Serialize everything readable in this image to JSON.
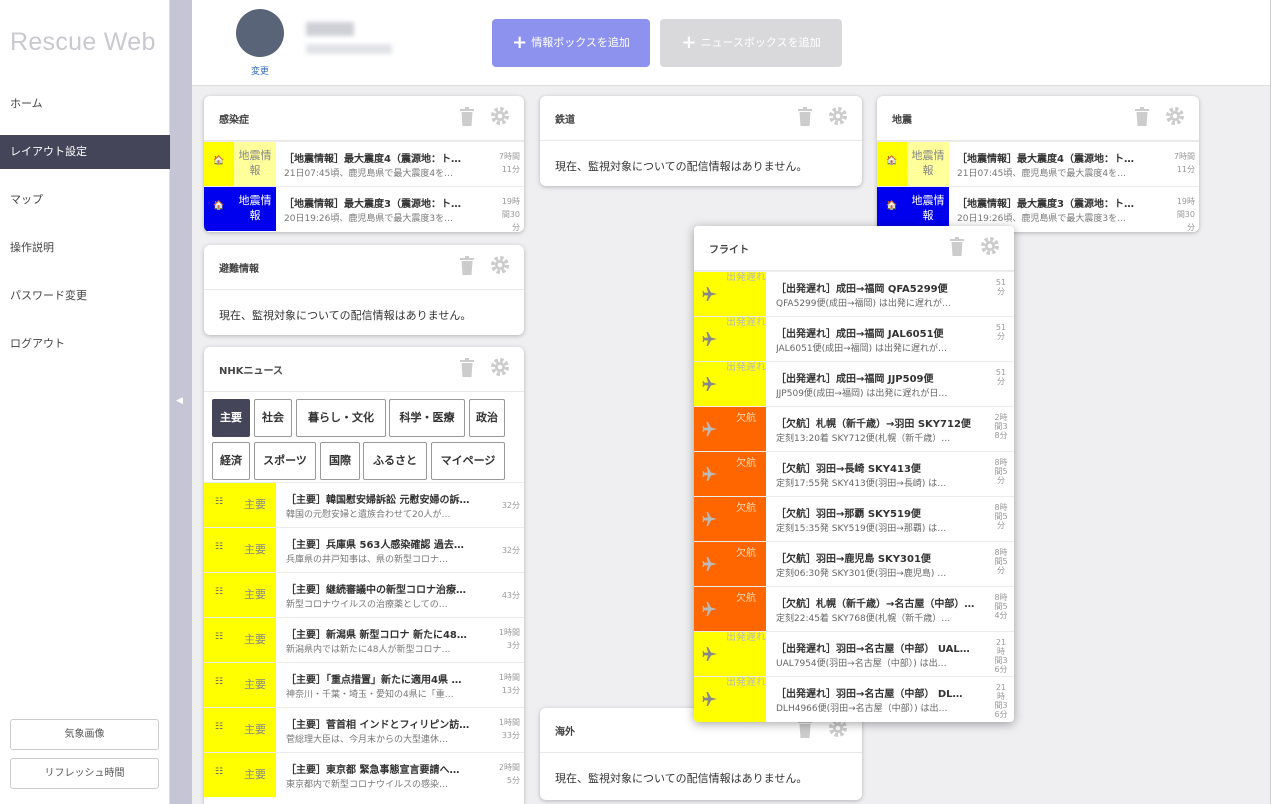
{
  "app": {
    "title": "Rescue Web"
  },
  "sidebar": {
    "items": [
      {
        "label": "ホーム",
        "active": false
      },
      {
        "label": "レイアウト設定",
        "active": true
      },
      {
        "label": "マップ",
        "active": false
      },
      {
        "label": "操作説明",
        "active": false
      },
      {
        "label": "パスワード変更",
        "active": false
      },
      {
        "label": "ログアウト",
        "active": false
      }
    ],
    "bottom_buttons": [
      "気象画像",
      "リフレッシュ時間"
    ],
    "collapse_icon": "chevron-left-icon"
  },
  "header": {
    "avatar_change": "変更",
    "add_info_box": "情報ボックスを追加",
    "add_news_box": "ニュースボックスを追加"
  },
  "colors": {
    "accent": "#8d92ee",
    "sidebar_active": "#45455a",
    "yellow": "#ffff00",
    "blue": "#0000ee",
    "orange": "#ff6600"
  },
  "cards": {
    "kansensho": {
      "title": "感染症",
      "rows": [
        {
          "badge": "地震情報",
          "headline": "［地震情報］最大震度4（震源地：ト…",
          "detail": "21日07:45頃、鹿児島県で最大震度4を…",
          "time": "7時間11分",
          "style": "yellow"
        },
        {
          "badge": "地震情報",
          "headline": "［地震情報］最大震度3（震源地：ト…",
          "detail": "20日19:26頃、鹿児島県で最大震度3を…",
          "time": "19時間30分",
          "style": "blue"
        }
      ]
    },
    "tetsudo": {
      "title": "鉄道",
      "empty": "現在、監視対象についての配信情報はありません。"
    },
    "jishin": {
      "title": "地震",
      "rows": [
        {
          "badge": "地震情報",
          "headline": "［地震情報］最大震度4（震源地：ト…",
          "detail": "21日07:45頃、鹿児島県で最大震度4を…",
          "time": "7時間11分",
          "style": "yellow"
        },
        {
          "badge": "地震情報",
          "headline": "［地震情報］最大震度3（震源地：ト…",
          "detail": "20日19:26頃、鹿児島県で最大震度3を…",
          "time": "19時間30分",
          "style": "blue"
        }
      ]
    },
    "hinan": {
      "title": "避難情報",
      "empty": "現在、監視対象についての配信情報はありません。"
    },
    "kaigai": {
      "title": "海外",
      "empty": "現在、監視対象についての配信情報はありません。"
    },
    "nhk": {
      "title": "NHKニュース",
      "categories": [
        "主要",
        "社会",
        "暮らし・文化",
        "科学・医療",
        "政治",
        "経済",
        "スポーツ",
        "国際",
        "ふるさと",
        "マイページ"
      ],
      "active_category": "主要",
      "rows": [
        {
          "badge": "主要",
          "headline": "［主要］韓国慰安婦訴訟 元慰安婦の訴…",
          "detail": "韓国の元慰安婦と遺族合わせて20人が…",
          "time": "32分"
        },
        {
          "badge": "主要",
          "headline": "［主要］兵庫県 563人感染確認 過去…",
          "detail": "兵庫県の井戸知事は、県の新型コロナ…",
          "time": "32分"
        },
        {
          "badge": "主要",
          "headline": "［主要］継続審議中の新型コロナ治療…",
          "detail": "新型コロナウイルスの治療薬としての…",
          "time": "43分"
        },
        {
          "badge": "主要",
          "headline": "［主要］新潟県 新型コロナ 新たに48…",
          "detail": "新潟県内では新たに48人が新型コロナ…",
          "time": "1時間3分"
        },
        {
          "badge": "主要",
          "headline": "［主要］「重点措置」新たに適用4県 …",
          "detail": "神奈川・千葉・埼玉・愛知の4県に「重…",
          "time": "1時間13分"
        },
        {
          "badge": "主要",
          "headline": "［主要］菅首相 インドとフィリピン訪…",
          "detail": "菅総理大臣は、今月末からの大型連休…",
          "time": "1時間33分"
        },
        {
          "badge": "主要",
          "headline": "［主要］東京都 緊急事態宣言要請へ…",
          "detail": "東京都内で新型コロナウイルスの感染…",
          "time": "2時間5分"
        }
      ]
    },
    "flight": {
      "title": "フライト",
      "rows": [
        {
          "badge": "出発遅れ",
          "type": "delay",
          "headline": "［出発遅れ］成田→福岡 QFA5299便",
          "detail": "QFA5299便(成田→福岡) は出発に遅れが…",
          "time": "51分"
        },
        {
          "badge": "出発遅れ",
          "type": "delay",
          "headline": "［出発遅れ］成田→福岡 JAL6051便",
          "detail": "JAL6051便(成田→福岡) は出発に遅れが…",
          "time": "51分"
        },
        {
          "badge": "出発遅れ",
          "type": "delay",
          "headline": "［出発遅れ］成田→福岡 JJP509便",
          "detail": "JJP509便(成田→福岡) は出発に遅れが日…",
          "time": "51分"
        },
        {
          "badge": "欠航",
          "type": "cancel",
          "headline": "［欠航］札幌（新千歳）→羽田 SKY712便",
          "detail": "定刻13:20着 SKY712便(札幌（新千歳）…",
          "time": "2時間38分"
        },
        {
          "badge": "欠航",
          "type": "cancel",
          "headline": "［欠航］羽田→長崎 SKY413便",
          "detail": "定刻17:55発 SKY413便(羽田→長崎) は…",
          "time": "8時間5分"
        },
        {
          "badge": "欠航",
          "type": "cancel",
          "headline": "［欠航］羽田→那覇 SKY519便",
          "detail": "定刻15:35発 SKY519便(羽田→那覇) は…",
          "time": "8時間5分"
        },
        {
          "badge": "欠航",
          "type": "cancel",
          "headline": "［欠航］羽田→鹿児島 SKY301便",
          "detail": "定刻06:30発 SKY301便(羽田→鹿児島) …",
          "time": "8時間5分"
        },
        {
          "badge": "欠航",
          "type": "cancel",
          "headline": "［欠航］札幌（新千歳）→名古屋（中部）…",
          "detail": "定刻22:45着 SKY768便(札幌（新千歳）…",
          "time": "8時間54分"
        },
        {
          "badge": "出発遅れ",
          "type": "delay",
          "headline": "［出発遅れ］羽田→名古屋（中部） UAL…",
          "detail": "UAL7954便(羽田→名古屋（中部）) は出…",
          "time": "21時間36分"
        },
        {
          "badge": "出発遅れ",
          "type": "delay",
          "headline": "［出発遅れ］羽田→名古屋（中部） DL…",
          "detail": "DLH4966便(羽田→名古屋（中部）) は出…",
          "time": "21時間36分"
        }
      ]
    }
  }
}
